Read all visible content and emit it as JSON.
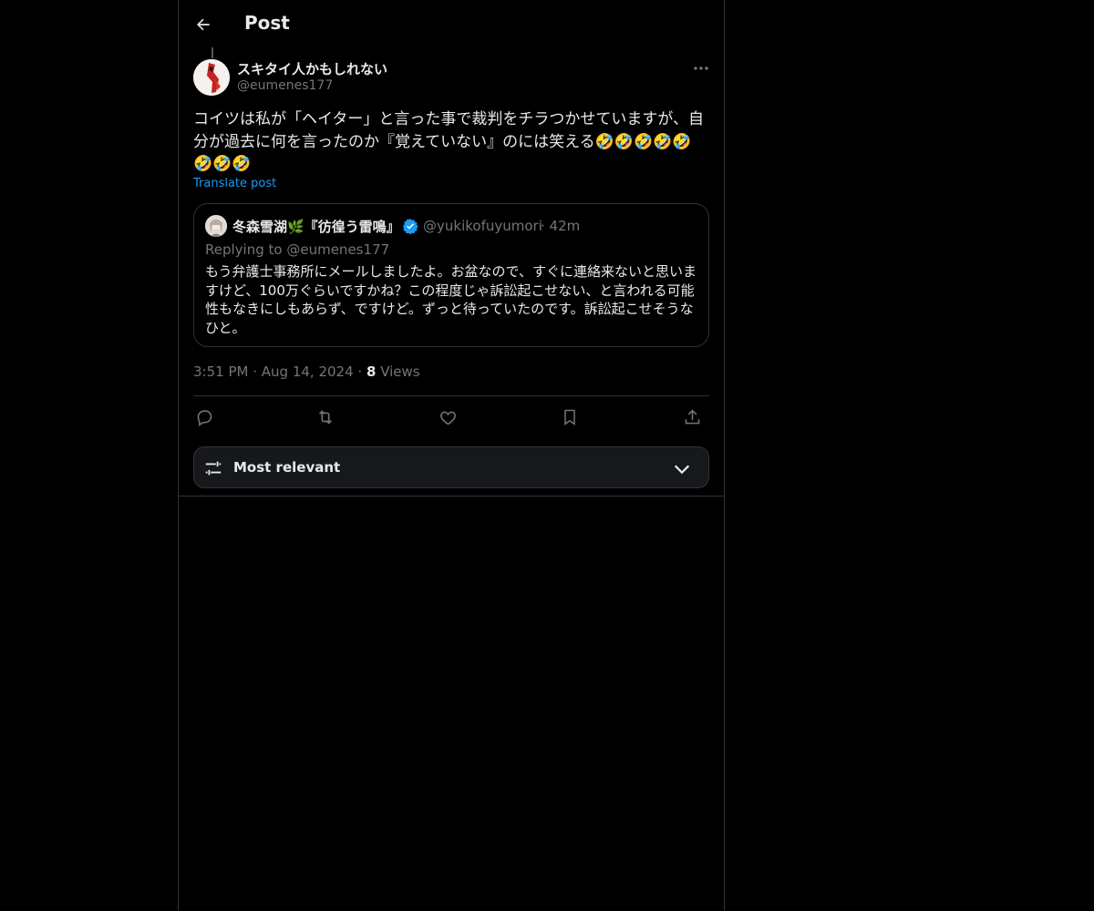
{
  "header": {
    "title": "Post",
    "back_icon": "arrow-left-icon"
  },
  "post": {
    "author_name": "スキタイ人かもしれない",
    "author_handle": "@eumenes177",
    "text": "コイツは私が「ヘイター」と言った事で裁判をチラつかせていますが、自分が過去に何を言ったのか『覚えていない』のには笑える🤣🤣🤣🤣🤣🤣🤣🤣",
    "translate_label": "Translate post",
    "time": "3:51 PM",
    "date": "Aug 14, 2024",
    "views_count": "8",
    "views_label": "Views"
  },
  "quote": {
    "name": "冬森雪湖🌿『彷徨う雷鳴』",
    "verified": true,
    "handle": "@yukikofuyumori",
    "time": "42m",
    "replying_prefix": "Replying to",
    "replying_handle": "@eumenes177",
    "text": "もう弁護士事務所にメールしましたよ。お盆なので、すぐに連絡来ないと思いますけど、100万ぐらいですかね？この程度じゃ訴訟起こせない、と言われる可能性もなきにしもあらず、ですけど。ずっと待っていたのです。訴訟起こせそうなひと。"
  },
  "actions": [
    "reply-icon",
    "repost-icon",
    "like-icon",
    "bookmark-icon",
    "share-icon"
  ],
  "sort": {
    "label": "Most relevant"
  },
  "colors": {
    "background": "#000000",
    "accent": "#1d9bf0",
    "secondary_text": "#71767b",
    "border": "#2f3336"
  }
}
